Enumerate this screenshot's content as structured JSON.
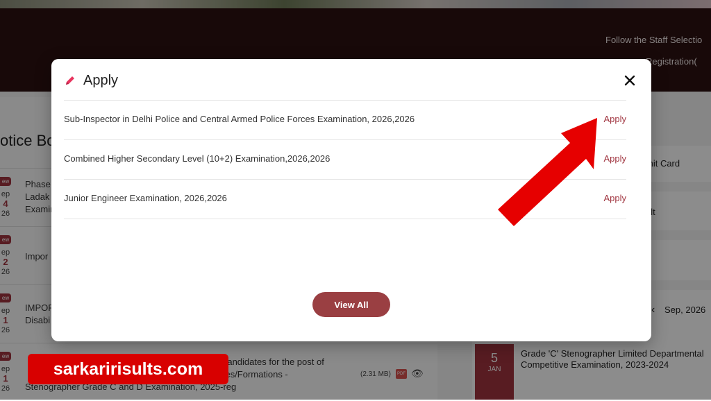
{
  "background": {
    "banner_line1": "Follow the Staff Selectio",
    "banner_line2": "Registration(",
    "notice_heading": "otice Bo",
    "notices": [
      {
        "badge": "ew",
        "month": "ep",
        "day": "4",
        "year": "26",
        "line1": "Phase",
        "line2": "Ladak",
        "line3": "Examir"
      },
      {
        "badge": "ew",
        "month": "ep",
        "day": "2",
        "year": "26",
        "line1": "Impor",
        "line2": "",
        "line3": ""
      },
      {
        "badge": "ew",
        "month": "ep",
        "day": "1",
        "year": "26",
        "line1": "IMPOR",
        "line2": "Disabi",
        "line3": ""
      },
      {
        "badge": "ew",
        "month": "ep",
        "day": "1",
        "year": "26",
        "line1": "d candidates for the post of",
        "line2": "ones/Formations -",
        "line3": "Stenographer Grade C and D Examination, 2025-reg"
      }
    ],
    "pdf_size": "(2.31 MB)",
    "pdf_label": "PDF",
    "right_items": [
      "mit Card",
      "ult"
    ],
    "calendar_month_label": "Sep, 2026",
    "calendar_chevron": "‹",
    "event_day": "5",
    "event_month": "JAN",
    "event_text_line1": "Grade 'C' Stenographer Limited Departmental",
    "event_text_line2": "Competitive Examination, 2023-2024"
  },
  "modal": {
    "title": "Apply",
    "close_label": "×",
    "rows": [
      {
        "name": "Sub-Inspector in Delhi Police and Central Armed Police Forces Examination, 2026,2026",
        "action": "Apply"
      },
      {
        "name": "Combined Higher Secondary Level (10+2) Examination,2026,2026",
        "action": "Apply"
      },
      {
        "name": "Junior Engineer Examination, 2026,2026",
        "action": "Apply"
      }
    ],
    "view_all_label": "View All"
  },
  "watermark": "sarkaririsults.com",
  "colors": {
    "accent": "#a0343f",
    "button": "#9a3f42",
    "pencil": "#e8335d",
    "arrow": "#e60000",
    "banner": "#2d1212"
  },
  "icons": {
    "title": "pencil-icon",
    "close": "close-icon",
    "pdf": "pdf-icon",
    "view": "eye-icon"
  }
}
